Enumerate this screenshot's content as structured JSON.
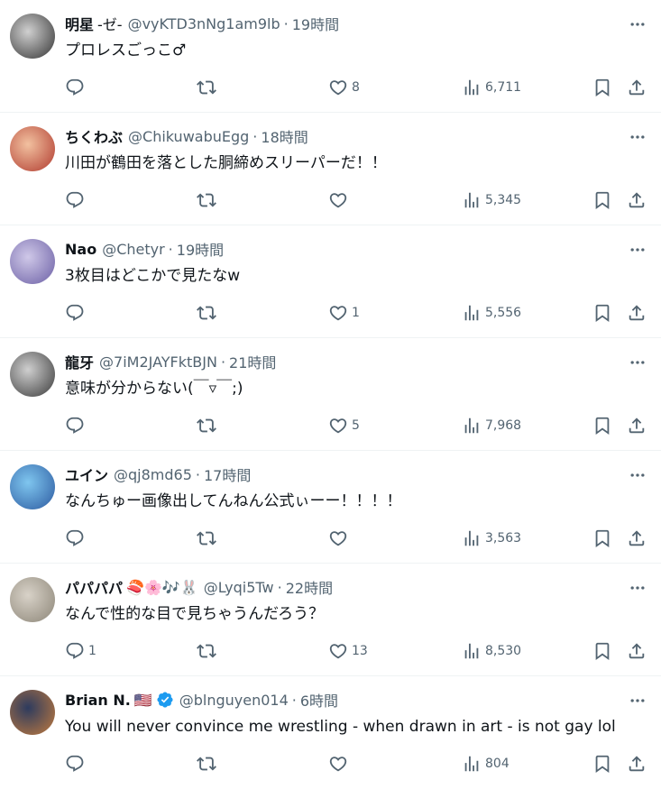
{
  "posts": [
    {
      "name": "明星",
      "name_extra": "-ゼ-",
      "handle": "@vyKTD3nNg1am9lb",
      "time": "19時間",
      "text": "プロレスごっこ♂",
      "stats": {
        "reply": "",
        "retweet": "",
        "like": "8",
        "views": "6,711"
      },
      "avatar_colors": [
        "#d0d0d0",
        "#333333"
      ]
    },
    {
      "name": "ちくわぶ",
      "name_extra": "",
      "handle": "@ChikuwabuEgg",
      "time": "18時間",
      "text": "川田が鶴田を落とした胴締めスリーパーだ！！",
      "stats": {
        "reply": "",
        "retweet": "",
        "like": "",
        "views": "5,345"
      },
      "avatar_colors": [
        "#f2c1a0",
        "#b03a2e"
      ]
    },
    {
      "name": "Nao",
      "name_extra": "",
      "handle": "@Chetyr",
      "time": "19時間",
      "text": "3枚目はどこかで見たなw",
      "stats": {
        "reply": "",
        "retweet": "",
        "like": "1",
        "views": "5,556"
      },
      "avatar_colors": [
        "#cfc8e8",
        "#6b5fa5"
      ]
    },
    {
      "name": "龍牙",
      "name_extra": "",
      "handle": "@7iM2JAYFktBJN",
      "time": "21時間",
      "text": "意味が分からない(￣▿￣;)",
      "stats": {
        "reply": "",
        "retweet": "",
        "like": "5",
        "views": "7,968"
      },
      "avatar_colors": [
        "#cfcfcf",
        "#3a3a3a"
      ]
    },
    {
      "name": "ユイン",
      "name_extra": "",
      "handle": "@qj8md65",
      "time": "17時間",
      "text": "なんちゅー画像出してんねん公式ぃーー！！！！",
      "stats": {
        "reply": "",
        "retweet": "",
        "like": "",
        "views": "3,563"
      },
      "avatar_colors": [
        "#7fc6ef",
        "#2c5aa0"
      ]
    },
    {
      "name": "パパパパ",
      "name_extra": "🍣🌸🎶🐰",
      "handle": "@Lyqi5Tw",
      "time": "22時間",
      "text": "なんで性的な目で見ちゃうんだろう？",
      "stats": {
        "reply": "1",
        "retweet": "",
        "like": "13",
        "views": "8,530"
      },
      "avatar_colors": [
        "#d8d2c8",
        "#8c8577"
      ]
    },
    {
      "name": "Brian N.",
      "name_extra": "🇺🇸",
      "handle": "@blnguyen014",
      "time": "6時間",
      "text": "You will never convince me wrestling - when drawn in art - is not gay lol",
      "verified": true,
      "stats": {
        "reply": "",
        "retweet": "",
        "like": "",
        "views": "804"
      },
      "avatar_colors": [
        "#2d3b5e",
        "#c27b3e"
      ]
    }
  ],
  "icons": {
    "reply": "reply-icon",
    "retweet": "retweet-icon",
    "like": "heart-icon",
    "views": "views-icon",
    "bookmark": "bookmark-icon",
    "share": "share-icon",
    "more": "more-icon",
    "verified": "verified-badge-icon"
  },
  "colors": {
    "text": "#0f1419",
    "muted": "#536471",
    "verified": "#1d9bf0",
    "divider": "#eff3f4"
  },
  "separator": "·"
}
